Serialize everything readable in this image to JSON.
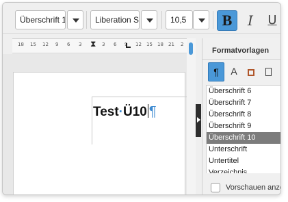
{
  "toolbar": {
    "style_value": "Überschrift 1",
    "font_value": "Liberation Sans",
    "size_value": "10,5",
    "bold_label": "B",
    "italic_label": "I",
    "underline_label": "U"
  },
  "ruler": {
    "ticks": [
      "18",
      "15",
      "12",
      "9",
      "6",
      "3",
      "3",
      "6",
      "9",
      "12",
      "15",
      "18",
      "21",
      "2"
    ]
  },
  "document": {
    "word1": "Test",
    "dot": "·",
    "word2": "Ü10",
    "pilcrow": "¶"
  },
  "panel": {
    "title": "Formatvorlagen",
    "style_types": [
      {
        "glyph": "¶",
        "name": "paragraph-styles-icon"
      },
      {
        "glyph": "A",
        "name": "character-styles-icon"
      },
      {
        "glyph": "",
        "name": "frame-styles-icon"
      },
      {
        "glyph": "",
        "name": "page-styles-icon"
      }
    ],
    "items": [
      "Überschrift 6",
      "Überschrift 7",
      "Überschrift 8",
      "Überschrift 9",
      "Überschrift 10",
      "Unterschrift",
      "Untertitel",
      "Verzeichnis"
    ],
    "selected_index": 4,
    "preview_label": "Vorschauen anzeigen"
  },
  "colors": {
    "accent": "#4a98d8",
    "selection": "#7c7c7c",
    "formatting_marks": "#3d8ad1"
  }
}
